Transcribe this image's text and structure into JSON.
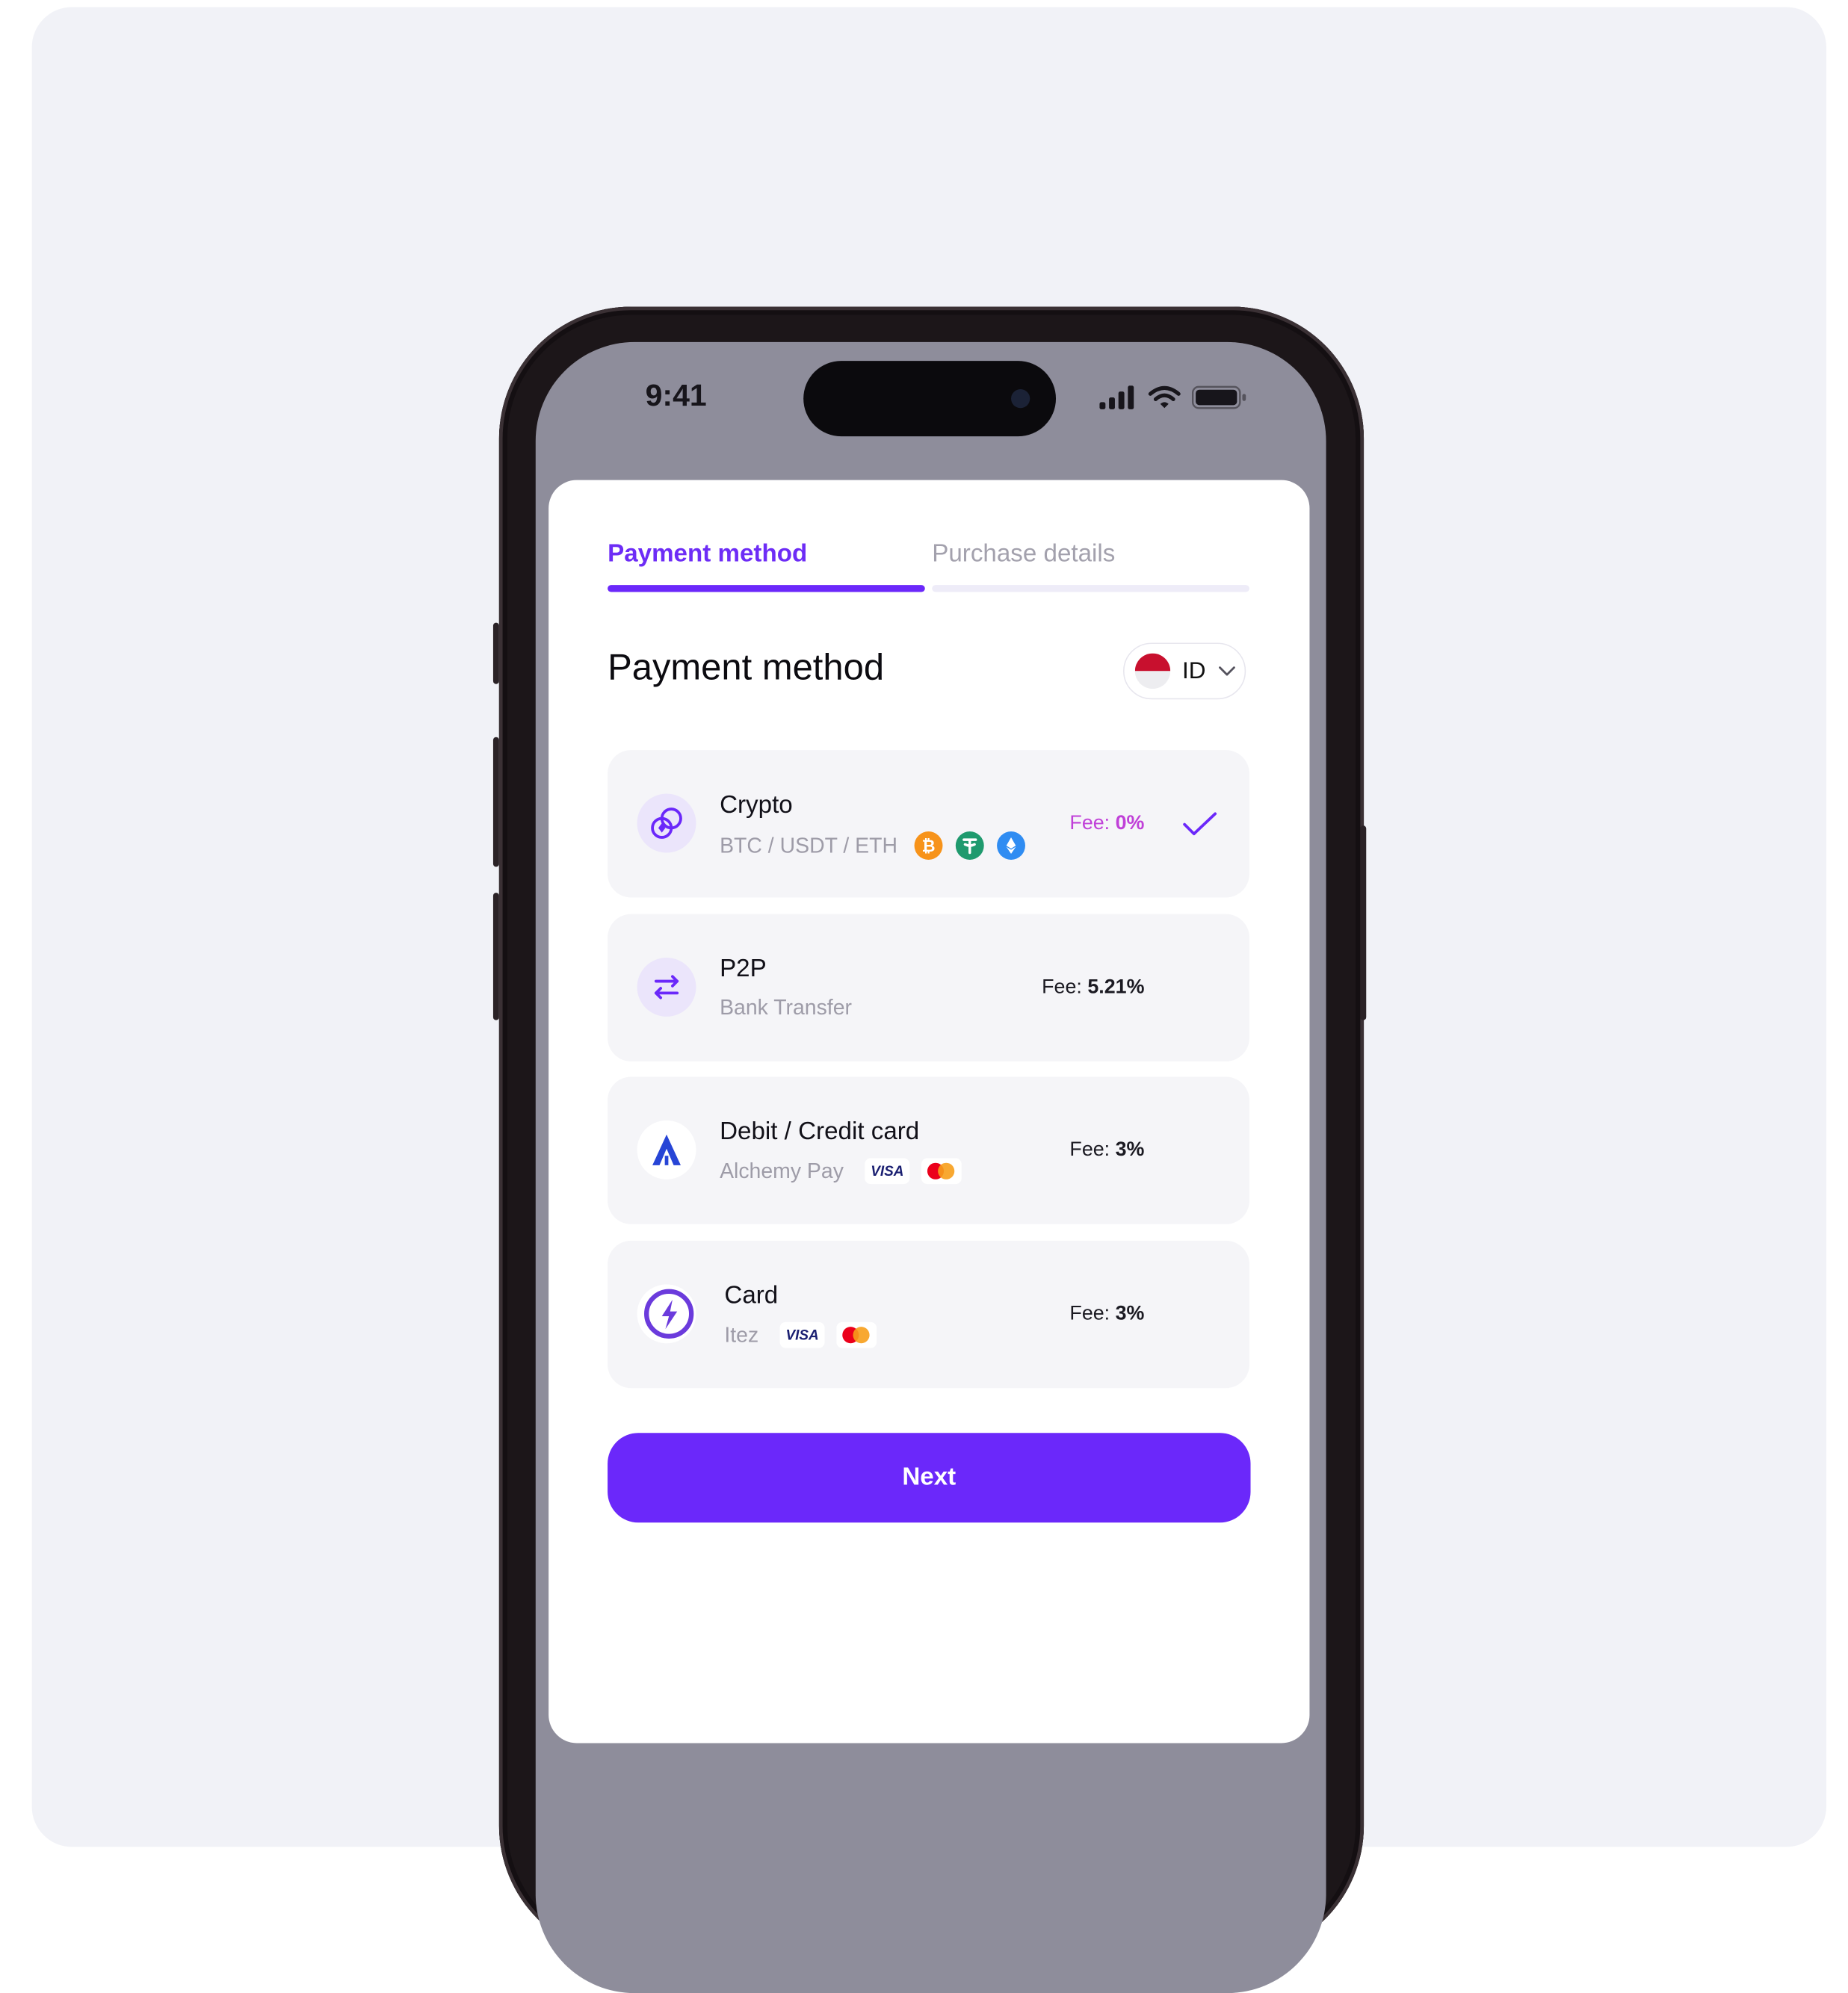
{
  "status_bar": {
    "time": "9:41"
  },
  "tabs": [
    {
      "label": "Payment method",
      "active": true
    },
    {
      "label": "Purchase details",
      "active": false
    }
  ],
  "page_title": "Payment method",
  "country_selector": {
    "code": "ID"
  },
  "colors": {
    "accent": "#6b28fa",
    "fee_highlight": "#c040d8",
    "row_bg": "#f5f5f8"
  },
  "methods": [
    {
      "title": "Crypto",
      "subtitle": "BTC / USDT / ETH",
      "fee_label": "Fee:",
      "fee_value": "0%",
      "selected": true,
      "coins": [
        "bitcoin-icon",
        "tether-icon",
        "ethereum-icon"
      ]
    },
    {
      "title": "P2P",
      "subtitle": "Bank Transfer",
      "fee_label": "Fee:",
      "fee_value": "5.21%",
      "selected": false
    },
    {
      "title": "Debit / Credit card",
      "subtitle": "Alchemy Pay",
      "fee_label": "Fee:",
      "fee_value": "3%",
      "selected": false,
      "badges": [
        "VISA",
        "mastercard-icon"
      ]
    },
    {
      "title": "Card",
      "subtitle": "Itez",
      "fee_label": "Fee:",
      "fee_value": "3%",
      "selected": false,
      "badges": [
        "VISA",
        "mastercard-icon"
      ]
    }
  ],
  "next_label": "Next"
}
